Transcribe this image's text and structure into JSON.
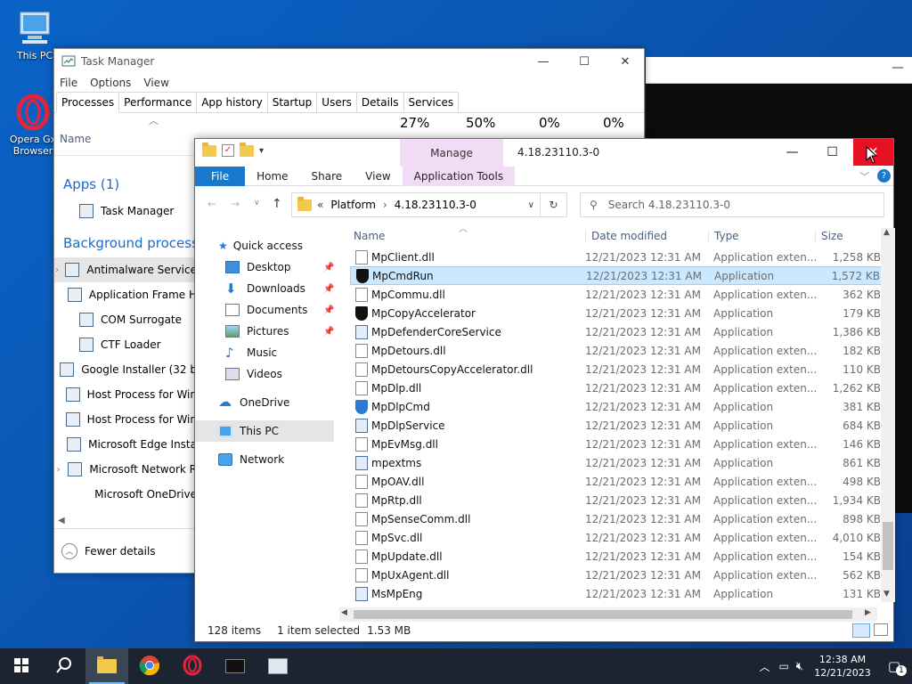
{
  "desktop": {
    "icons": [
      {
        "label": "This PC"
      },
      {
        "label": "Opera GX Browser",
        "line1": "Opera Gx",
        "line2": "Browser"
      }
    ]
  },
  "task_manager": {
    "title": "Task Manager",
    "menu": [
      "File",
      "Options",
      "View"
    ],
    "tabs": [
      "Processes",
      "Performance",
      "App history",
      "Startup",
      "Users",
      "Details",
      "Services"
    ],
    "header": {
      "name": "Name",
      "percents": [
        "27%",
        "50%",
        "0%",
        "0%"
      ]
    },
    "apps_heading": "Apps (1)",
    "apps": [
      "Task Manager"
    ],
    "bg_heading": "Background processes",
    "background": [
      "Antimalware Service",
      "Application Frame H",
      "COM Surrogate",
      "CTF Loader",
      "Google Installer (32 b",
      "Host Process for Win",
      "Host Process for Win",
      "Microsoft Edge Insta",
      "Microsoft Network R",
      "Microsoft OneDrive"
    ],
    "fewer_details": "Fewer details"
  },
  "explorer": {
    "title": "4.18.23110.3-0",
    "manage": "Manage",
    "ribbon": {
      "file": "File",
      "home": "Home",
      "share": "Share",
      "view": "View",
      "tools": "Application Tools"
    },
    "breadcrumb": {
      "prefix": "«",
      "part1": "Platform",
      "sep": "›",
      "part2": "4.18.23110.3-0"
    },
    "search_placeholder": "Search 4.18.23110.3-0",
    "nav": {
      "quick_access": "Quick access",
      "desktop": "Desktop",
      "downloads": "Downloads",
      "documents": "Documents",
      "pictures": "Pictures",
      "music": "Music",
      "videos": "Videos",
      "onedrive": "OneDrive",
      "this_pc": "This PC",
      "network": "Network"
    },
    "columns": {
      "name": "Name",
      "date": "Date modified",
      "type": "Type",
      "size": "Size"
    },
    "files": [
      {
        "name": "MpClient.dll",
        "date": "12/21/2023 12:31 AM",
        "type": "Application exten...",
        "size": "1,258 KB",
        "icon": "dll"
      },
      {
        "name": "MpCmdRun",
        "date": "12/21/2023 12:31 AM",
        "type": "Application",
        "size": "1,572 KB",
        "icon": "shield"
      },
      {
        "name": "MpCommu.dll",
        "date": "12/21/2023 12:31 AM",
        "type": "Application exten...",
        "size": "362 KB",
        "icon": "dll"
      },
      {
        "name": "MpCopyAccelerator",
        "date": "12/21/2023 12:31 AM",
        "type": "Application",
        "size": "179 KB",
        "icon": "shield"
      },
      {
        "name": "MpDefenderCoreService",
        "date": "12/21/2023 12:31 AM",
        "type": "Application",
        "size": "1,386 KB",
        "icon": "app"
      },
      {
        "name": "MpDetours.dll",
        "date": "12/21/2023 12:31 AM",
        "type": "Application exten...",
        "size": "182 KB",
        "icon": "dll"
      },
      {
        "name": "MpDetoursCopyAccelerator.dll",
        "date": "12/21/2023 12:31 AM",
        "type": "Application exten...",
        "size": "110 KB",
        "icon": "dll"
      },
      {
        "name": "MpDlp.dll",
        "date": "12/21/2023 12:31 AM",
        "type": "Application exten...",
        "size": "1,262 KB",
        "icon": "dll"
      },
      {
        "name": "MpDlpCmd",
        "date": "12/21/2023 12:31 AM",
        "type": "Application",
        "size": "381 KB",
        "icon": "blue"
      },
      {
        "name": "MpDlpService",
        "date": "12/21/2023 12:31 AM",
        "type": "Application",
        "size": "684 KB",
        "icon": "app"
      },
      {
        "name": "MpEvMsg.dll",
        "date": "12/21/2023 12:31 AM",
        "type": "Application exten...",
        "size": "146 KB",
        "icon": "dll"
      },
      {
        "name": "mpextms",
        "date": "12/21/2023 12:31 AM",
        "type": "Application",
        "size": "861 KB",
        "icon": "app"
      },
      {
        "name": "MpOAV.dll",
        "date": "12/21/2023 12:31 AM",
        "type": "Application exten...",
        "size": "498 KB",
        "icon": "dll"
      },
      {
        "name": "MpRtp.dll",
        "date": "12/21/2023 12:31 AM",
        "type": "Application exten...",
        "size": "1,934 KB",
        "icon": "dll"
      },
      {
        "name": "MpSenseComm.dll",
        "date": "12/21/2023 12:31 AM",
        "type": "Application exten...",
        "size": "898 KB",
        "icon": "dll"
      },
      {
        "name": "MpSvc.dll",
        "date": "12/21/2023 12:31 AM",
        "type": "Application exten...",
        "size": "4,010 KB",
        "icon": "dll"
      },
      {
        "name": "MpUpdate.dll",
        "date": "12/21/2023 12:31 AM",
        "type": "Application exten...",
        "size": "154 KB",
        "icon": "dll"
      },
      {
        "name": "MpUxAgent.dll",
        "date": "12/21/2023 12:31 AM",
        "type": "Application exten...",
        "size": "562 KB",
        "icon": "dll"
      },
      {
        "name": "MsMpEng",
        "date": "12/21/2023 12:31 AM",
        "type": "Application",
        "size": "131 KB",
        "icon": "app"
      }
    ],
    "selected_index": 1,
    "status": {
      "count": "128 items",
      "selected": "1 item selected",
      "size": "1.53 MB"
    }
  },
  "taskbar": {
    "clock_time": "12:38 AM",
    "clock_date": "12/21/2023",
    "notifications": "1",
    "accent": "#76b9ed"
  }
}
